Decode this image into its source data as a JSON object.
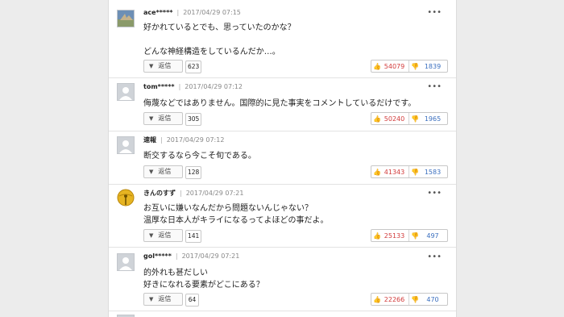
{
  "comments": [
    {
      "user": "ace*****",
      "date": "2017/04/29 07:15",
      "avatar": "landscape-avatar-icon",
      "lines": [
        "好かれているとでも、思っていたのかな？",
        "",
        "どんな神経構造をしているんだか…。"
      ],
      "reply_label": "返信",
      "replies": "623",
      "likes": "54079",
      "dislikes": "1839"
    },
    {
      "user": "tom*****",
      "date": "2017/04/29 07:12",
      "avatar": "default-user-icon",
      "lines": [
        "侮蔑などではありません。国際的に見た事実をコメントしているだけです。"
      ],
      "reply_label": "返信",
      "replies": "305",
      "likes": "50240",
      "dislikes": "1965"
    },
    {
      "user": "速報",
      "date": "2017/04/29 07:12",
      "avatar": "default-user-icon",
      "lines": [
        "断交するなら今こそ旬である。"
      ],
      "reply_label": "返信",
      "replies": "128",
      "likes": "41343",
      "dislikes": "1583"
    },
    {
      "user": "きんのすず",
      "date": "2017/04/29 07:21",
      "avatar": "gold-bell-icon",
      "lines": [
        "お互いに嫌いなんだから問題ないんじゃない？",
        "温厚な日本人がキライになるってよほどの事だよ。"
      ],
      "reply_label": "返信",
      "replies": "141",
      "likes": "25133",
      "dislikes": "497"
    },
    {
      "user": "gol*****",
      "date": "2017/04/29 07:21",
      "avatar": "default-user-icon",
      "lines": [
        "的外れも甚だしい",
        "好きになれる要素がどこにある？"
      ],
      "reply_label": "返信",
      "replies": "64",
      "likes": "22266",
      "dislikes": "470"
    }
  ],
  "ui": {
    "more_glyph": "•••",
    "reply_arrow": "▼",
    "like_icon": "thumbs-up-icon",
    "dislike_icon": "thumbs-down-icon",
    "like_color": "#d23b3b",
    "dislike_color": "#3b6fbf"
  }
}
